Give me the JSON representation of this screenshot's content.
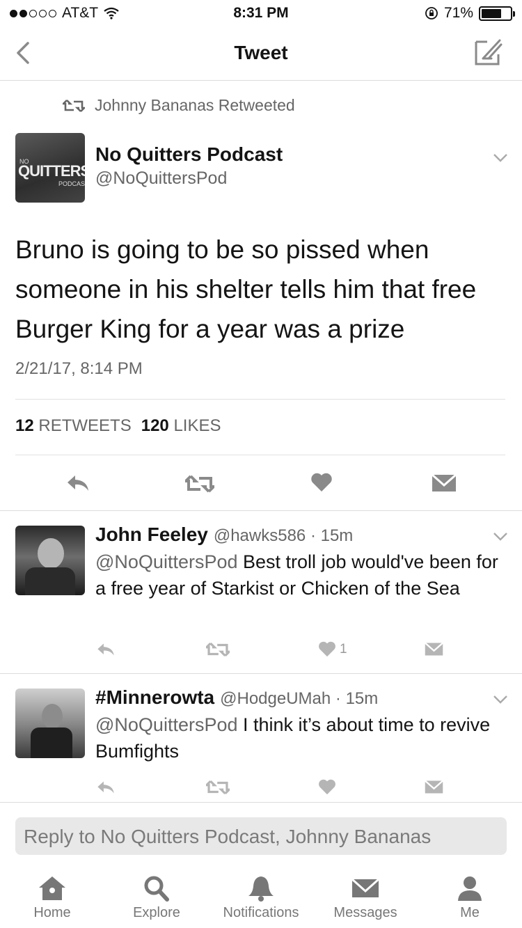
{
  "status_bar": {
    "carrier": "AT&T",
    "time": "8:31 PM",
    "battery": "71%",
    "battery_level": 0.71
  },
  "nav": {
    "title": "Tweet"
  },
  "retweet_context": "Johnny Bananas Retweeted",
  "main_tweet": {
    "avatar_text": {
      "small": "NO",
      "big": "QUITTERS",
      "sub": "PODCAST"
    },
    "name": "No Quitters Podcast",
    "handle": "@NoQuittersPod",
    "text": "Bruno is going to be so pissed when someone in his shelter tells him that free Burger King for a year was a prize",
    "timestamp": "2/21/17, 8:14 PM",
    "retweets_count": "12",
    "retweets_label": "RETWEETS",
    "likes_count": "120",
    "likes_label": "LIKES"
  },
  "replies": [
    {
      "name": "John Feeley",
      "meta": "@hawks586 · 15m",
      "mention": "@NoQuittersPod",
      "text": " Best troll job would've been for a free year of Starkist or Chicken of the Sea",
      "like_count": "1"
    },
    {
      "name": "#Minnerowta",
      "meta": "@HodgeUMah · 15m",
      "mention": "@NoQuittersPod",
      "text": " I think it’s about time to revive Bumfights",
      "like_count": ""
    }
  ],
  "reply_box": {
    "placeholder": "Reply to No Quitters Podcast, Johnny Bananas"
  },
  "tabs": [
    {
      "label": "Home",
      "icon": "home-icon"
    },
    {
      "label": "Explore",
      "icon": "search-icon"
    },
    {
      "label": "Notifications",
      "icon": "bell-icon"
    },
    {
      "label": "Messages",
      "icon": "envelope-icon"
    },
    {
      "label": "Me",
      "icon": "person-icon"
    }
  ],
  "colors": {
    "text": "#141414",
    "secondary": "#666666",
    "divider": "#dcdcdc",
    "icon": "#888888"
  }
}
